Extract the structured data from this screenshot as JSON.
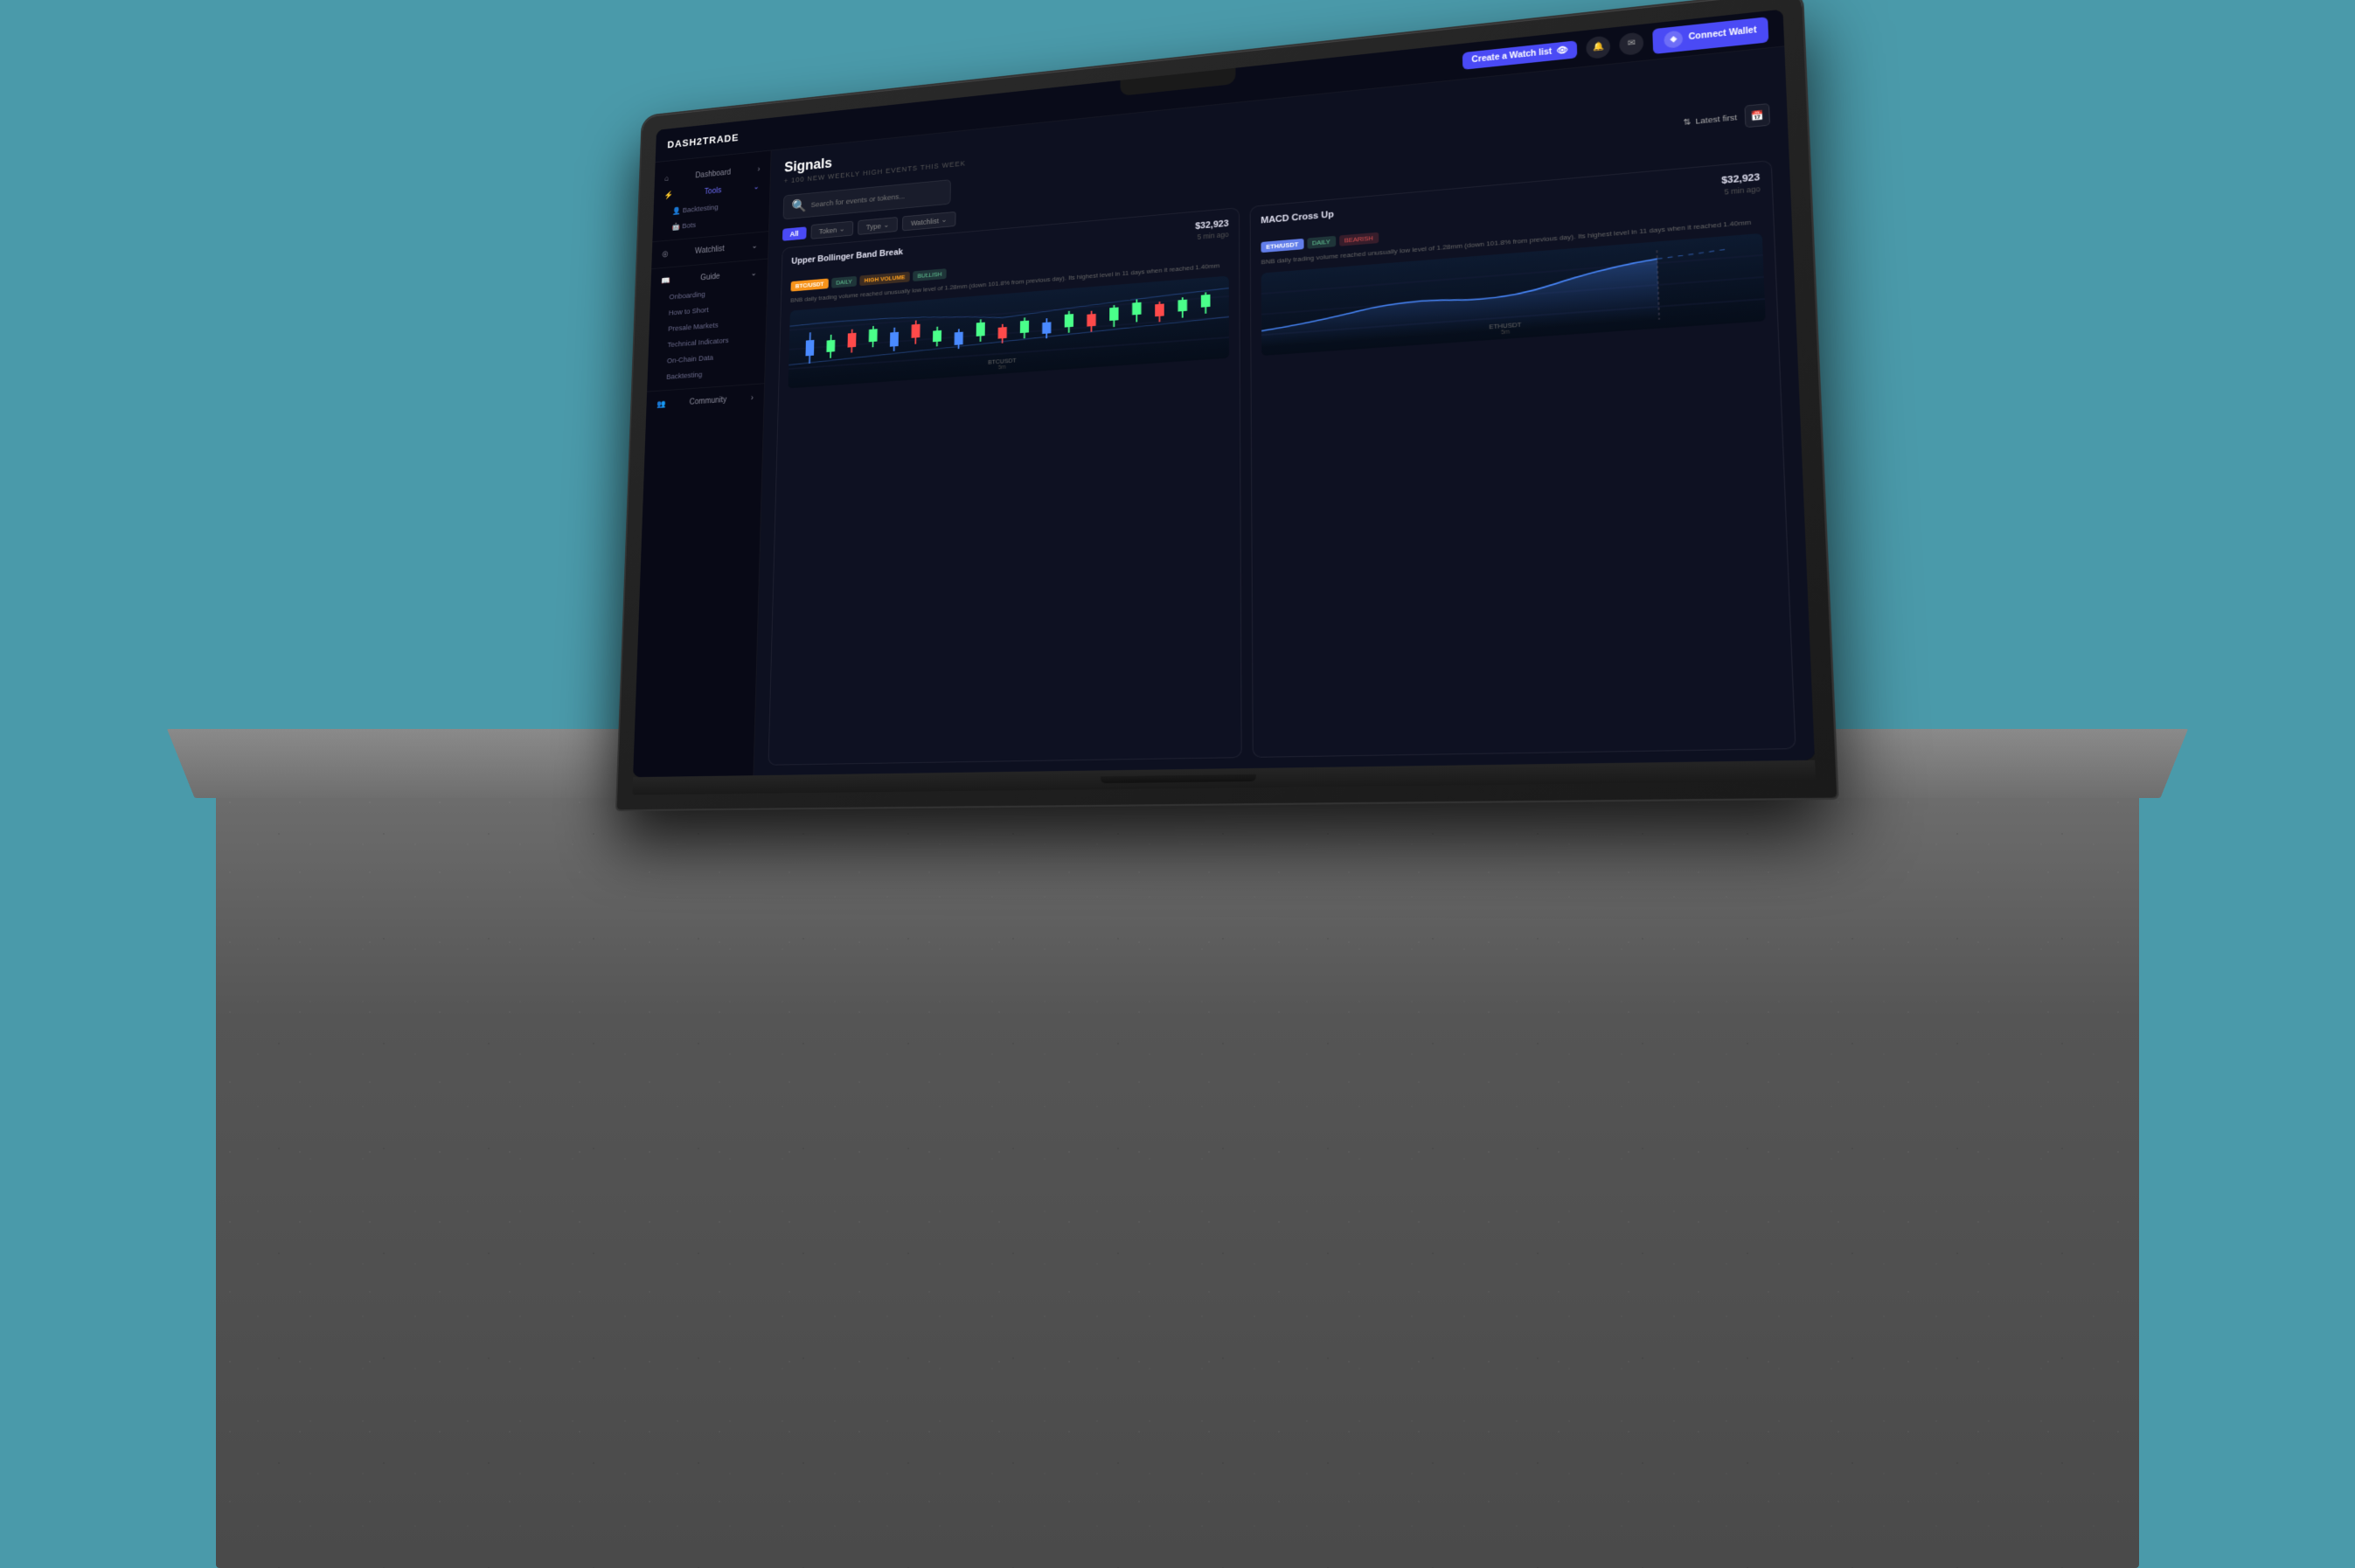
{
  "screen": {
    "logo": "DASH2TRADE",
    "topbar": {
      "create_watchlist": "Create a Watch list",
      "connect_wallet": "Connect Wallet"
    },
    "sidebar": {
      "dashboard": "Dashboard",
      "tools": "Tools",
      "backtesting": "Backtesting",
      "bots": "Bots",
      "watchlist": "Watchlist",
      "guide": "Guide",
      "onboarding": "Onboarding",
      "how_to_short": "How to Short",
      "presale_markets": "Presale Markets",
      "technical_indicators": "Technical Indicators",
      "on_chain_data": "On-Chain Data",
      "backtesting_guide": "Backtesting",
      "community": "Community"
    },
    "main": {
      "title": "Signals",
      "subtitle": "+ 100 NEW WEEKLY HIGH EVENTS THIS WEEK",
      "search_placeholder": "Search for events or tokens...",
      "sort_label": "Latest first",
      "filter_all": "All",
      "filter_token": "Token",
      "filter_type": "Type",
      "filter_watchlist": "Watchlist",
      "cards": [
        {
          "title": "Upper Bollinger Band Break",
          "price": "$32,923",
          "time": "5 min ago",
          "token": "BTC/USDT",
          "tags": [
            "DAILY",
            "HIGH VOLUME",
            "BULLISH"
          ],
          "description": "BNB daily trading volume reached unusually low level of 1.28mm (down 101.8% from previous day). Its highest level in 11 days when it reached 1.40mm",
          "chart_label": "BTCUSDT",
          "chart_sub": "5m",
          "chart_type": "candlestick"
        },
        {
          "title": "MACD Cross Up",
          "price": "$32,923",
          "time": "5 min ago",
          "token": "ETH/USDT",
          "tags": [
            "DAILY",
            "BEARISH"
          ],
          "description": "BNB daily trading volume reached unusually low level of 1.28mm (down 101.8% from previous day). Its highest level in 11 days when it reached 1.40mm",
          "chart_label": "ETHUSDT",
          "chart_sub": "5m",
          "chart_type": "line"
        }
      ]
    }
  },
  "background_color": "#4a9aaa"
}
